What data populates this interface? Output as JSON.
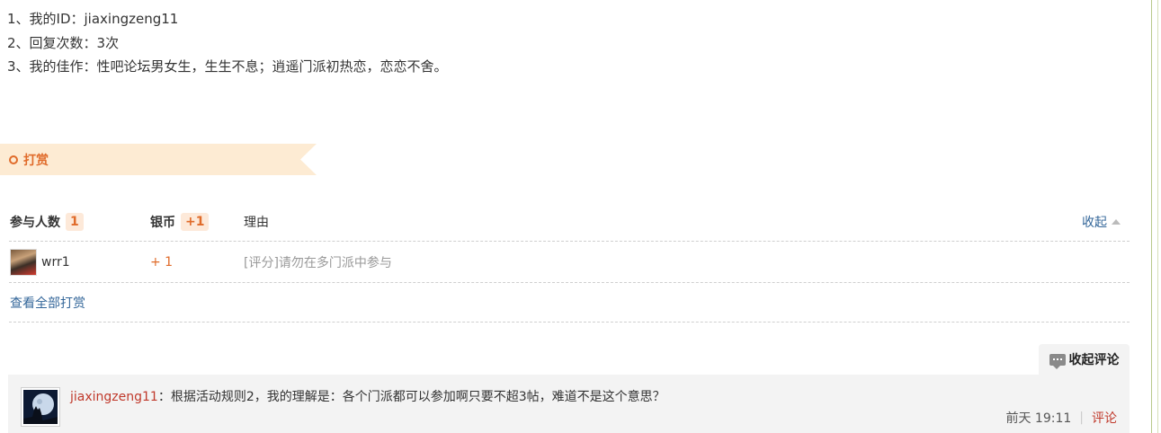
{
  "intro": {
    "line1": "1、我的ID：jiaxingzeng11",
    "line2": "2、回复次数：3次",
    "line3": "3、我的佳作：性吧论坛男女生，生生不息；逍遥门派初热恋，恋恋不舍。"
  },
  "reward": {
    "section_title": "打赏",
    "headers": {
      "participants_label": "参与人数",
      "participants_count": "1",
      "silver_label": "银币",
      "silver_total": "+1",
      "reason_label": "理由"
    },
    "collapse_label": "收起",
    "rows": [
      {
        "user": "wrr1",
        "silver": "+ 1",
        "reason": "[评分]请勿在多门派中参与"
      }
    ],
    "view_all_label": "查看全部打赏"
  },
  "comments": {
    "toggle_label": "收起评论",
    "items": [
      {
        "user": "jiaxingzeng11",
        "text": "：根据活动规则2，我的理解是：各个门派都可以参加啊只要不超3帖，难道不是这个意思？",
        "time": "前天 19:11",
        "reply_label": "评论"
      }
    ]
  },
  "colors": {
    "accent_orange": "#e06b2a",
    "link_blue": "#336699",
    "username_red": "#c0392b",
    "banner_bg": "#fdebd3"
  }
}
